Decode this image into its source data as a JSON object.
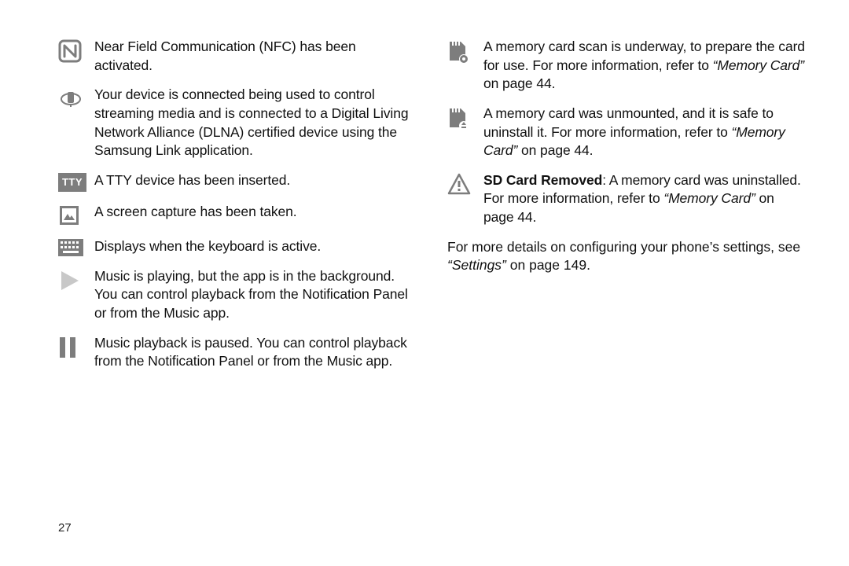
{
  "page_number": "27",
  "closing": {
    "text": "For more details on configuring your phone’s settings, see ",
    "ref_italic": "“Settings”",
    "ref_tail": " on page 149."
  },
  "left": [
    {
      "icon": "nfc-icon",
      "text": "Near Field Communication (NFC) has been activated."
    },
    {
      "icon": "dlna-icon",
      "text": "Your device is connected being used to control streaming media and is connected to a Digital Living Network Alliance (DLNA) certified device using the Samsung Link application."
    },
    {
      "icon": "tty-icon",
      "text": "A TTY device has been inserted."
    },
    {
      "icon": "screenshot-icon",
      "text": "A screen capture has been taken."
    },
    {
      "icon": "keyboard-icon",
      "text": "Displays when the keyboard is active."
    },
    {
      "icon": "play-icon",
      "text": "Music is playing, but the app is in the background. You can control playback from the Notification Panel or from the Music app."
    },
    {
      "icon": "pause-icon",
      "text": "Music playback is paused. You can control playback from the Notification Panel or from the Music app."
    }
  ],
  "right": [
    {
      "icon": "sd-scan-icon",
      "text": "A memory card scan is underway, to prepare the card for use. For more information, refer to ",
      "ref_italic": "“Memory Card”",
      "ref_tail": " on page 44."
    },
    {
      "icon": "sd-unmount-icon",
      "text": "A memory card was unmounted, and it is safe to uninstall it. For more information, refer to ",
      "ref_italic": "“Memory Card”",
      "ref_tail": " on page 44."
    },
    {
      "icon": "warning-icon",
      "lead_bold": "SD Card Removed",
      "text": ": A memory card was uninstalled. For more information, refer to ",
      "ref_italic": "“Memory Card”",
      "ref_tail": " on page 44."
    }
  ]
}
